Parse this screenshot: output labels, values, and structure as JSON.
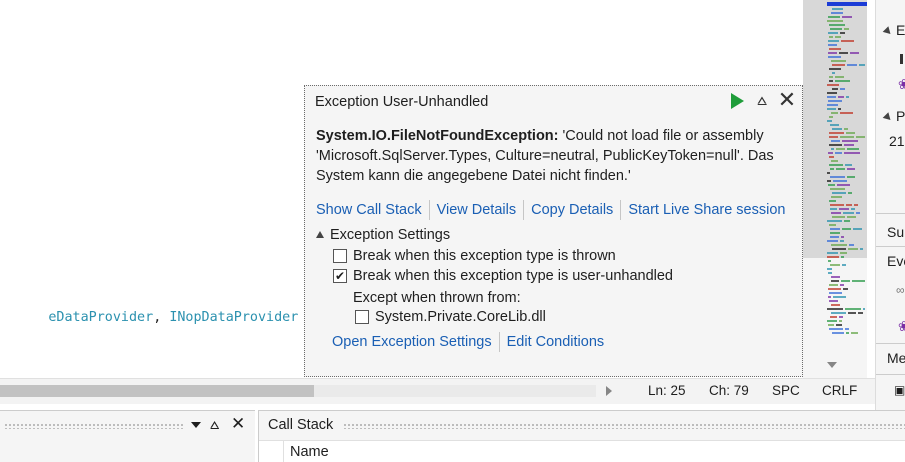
{
  "editor": {
    "code_parts": [
      {
        "text": "eDataProvider",
        "kind": "type"
      },
      {
        "text": ", ",
        "kind": "punct"
      },
      {
        "text": "INopDataProvider",
        "kind": "type"
      }
    ]
  },
  "right_panel": {
    "items": [
      "E",
      "P",
      "21",
      "Sur",
      "Eve",
      "Me"
    ]
  },
  "statusbar": {
    "line": "Ln: 25",
    "col": "Ch: 79",
    "indent": "SPC",
    "line_ending": "CRLF"
  },
  "bottom_panel": {
    "call_stack_title": "Call Stack",
    "name_column": "Name"
  },
  "popup": {
    "title": "Exception User-Unhandled",
    "exception_type": "System.IO.FileNotFoundException:",
    "exception_message": " 'Could not load file or assembly 'Microsoft.SqlServer.Types, Culture=neutral, PublicKeyToken=null'. Das System kann die angegebene Datei nicht finden.'",
    "links": {
      "show_call_stack": "Show Call Stack",
      "view_details": "View Details",
      "copy_details": "Copy Details",
      "live_share": "Start Live Share session"
    },
    "settings_header": "Exception Settings",
    "options": {
      "break_thrown": "Break when this exception type is thrown",
      "break_thrown_checked": false,
      "break_unhandled": "Break when this exception type is user-unhandled",
      "break_unhandled_checked": true,
      "except_label": "Except when thrown from:",
      "corelib": "System.Private.CoreLib.dll",
      "corelib_checked": false
    },
    "links2": {
      "open_settings": "Open Exception Settings",
      "edit_conditions": "Edit Conditions"
    }
  },
  "colors": {
    "link": "#1a5fb4",
    "continue_green": "#1f9d3a",
    "code_type": "#2b91af",
    "hint_purple": "#7b2fa5"
  }
}
